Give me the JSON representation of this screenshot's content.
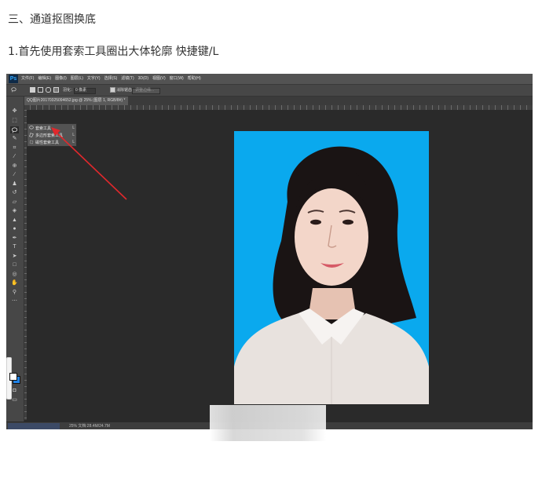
{
  "article": {
    "section_heading": "三、通道抠图换底",
    "step_heading": "1.首先使用套索工具圈出大体轮廓 快捷键/L"
  },
  "photoshop": {
    "logo": "Ps",
    "menu": [
      "文件(F)",
      "编辑(E)",
      "图像(I)",
      "图层(L)",
      "文字(Y)",
      "选择(S)",
      "滤镜(T)",
      "3D(D)",
      "视图(V)",
      "窗口(W)",
      "帮助(H)"
    ],
    "options_bar": {
      "feather_label": "羽化：",
      "feather_value": "0 像素",
      "antialias_label": "消除锯齿",
      "refine_edge_label": "调整边缘..."
    },
    "document_tab": "QQ图片20170325094652.jpg @ 25% (图层 1, RGB/8#) *",
    "flyout_menu": [
      {
        "label": "套索工具",
        "shortcut": "L",
        "icon": "lasso-icon"
      },
      {
        "label": "多边形套索工具",
        "shortcut": "L",
        "icon": "polygon-lasso-icon"
      },
      {
        "label": "磁性套索工具",
        "shortcut": "L",
        "icon": "magnetic-lasso-icon"
      }
    ],
    "status_text": "25%    文档:28.4M/24.7M",
    "colors": {
      "canvas_background": "#2a2a2a",
      "photo_backdrop": "#0aa9ee",
      "annotation_arrow": "#e0282c",
      "foreground_swatch": "#ffffff",
      "background_swatch": "#1f82e6"
    }
  }
}
